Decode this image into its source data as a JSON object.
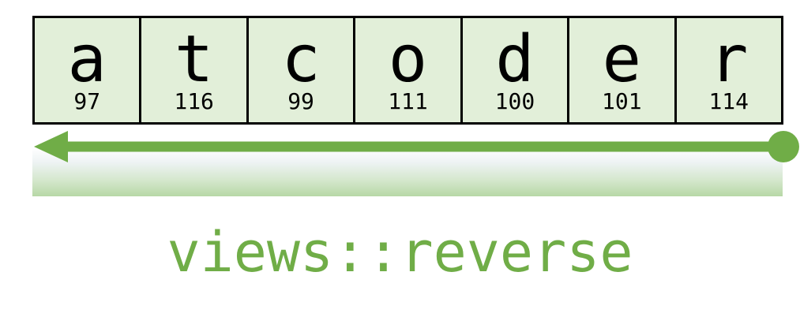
{
  "cells": [
    {
      "char": "a",
      "code": "97"
    },
    {
      "char": "t",
      "code": "116"
    },
    {
      "char": "c",
      "code": "99"
    },
    {
      "char": "o",
      "code": "111"
    },
    {
      "char": "d",
      "code": "100"
    },
    {
      "char": "e",
      "code": "101"
    },
    {
      "char": "r",
      "code": "114"
    }
  ],
  "caption": "views::reverse",
  "colors": {
    "cell_fill": "#e2efd9",
    "accent": "#70ad47",
    "border": "#000000"
  },
  "arrow": {
    "direction": "right-to-left"
  }
}
